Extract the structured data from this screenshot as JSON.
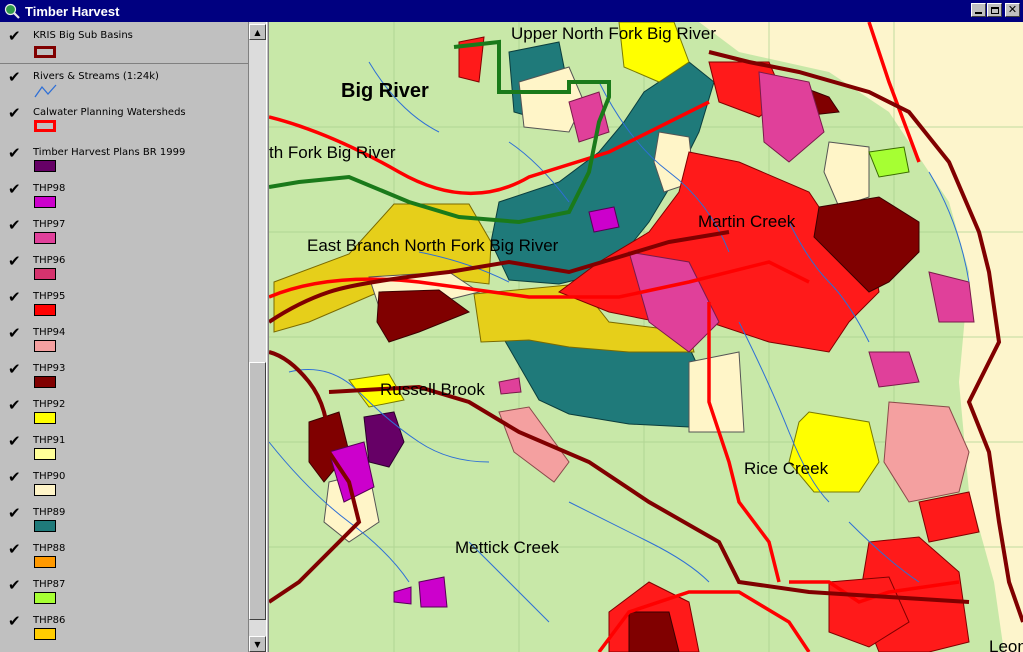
{
  "window": {
    "title": "Timber Harvest",
    "icon": "globe-search-icon",
    "buttons": [
      "minimize",
      "maximize",
      "close"
    ]
  },
  "legend": {
    "layers": [
      {
        "name": "KRIS Big Sub Basins",
        "checked": true,
        "symbol": "outline",
        "color": "#800000"
      },
      {
        "name": "Rivers & Streams (1:24k)",
        "checked": true,
        "symbol": "line",
        "color": "#2e6fd6"
      },
      {
        "name": "Calwater Planning Watersheds",
        "checked": true,
        "symbol": "outline",
        "color": "#ff0000"
      },
      {
        "name": "Timber Harvest Plans BR 1999",
        "checked": true,
        "symbol": "fill",
        "color": "#660066"
      },
      {
        "name": "THP98",
        "checked": true,
        "symbol": "fill",
        "color": "#cc00cc"
      },
      {
        "name": "THP97",
        "checked": true,
        "symbol": "fill",
        "color": "#e0409a"
      },
      {
        "name": "THP96",
        "checked": true,
        "symbol": "fill",
        "color": "#d6336e"
      },
      {
        "name": "THP95",
        "checked": true,
        "symbol": "fill",
        "color": "#ff0000"
      },
      {
        "name": "THP94",
        "checked": true,
        "symbol": "fill",
        "color": "#f4a0a0"
      },
      {
        "name": "THP93",
        "checked": true,
        "symbol": "fill",
        "color": "#800000"
      },
      {
        "name": "THP92",
        "checked": true,
        "symbol": "fill",
        "color": "#ffff00"
      },
      {
        "name": "THP91",
        "checked": true,
        "symbol": "fill",
        "color": "#ffff99"
      },
      {
        "name": "THP90",
        "checked": true,
        "symbol": "fill",
        "color": "#fff5c8"
      },
      {
        "name": "THP89",
        "checked": true,
        "symbol": "fill",
        "color": "#1f7a7a"
      },
      {
        "name": "THP88",
        "checked": true,
        "symbol": "fill",
        "color": "#ff9900"
      },
      {
        "name": "THP87",
        "checked": true,
        "symbol": "fill",
        "color": "#a6ff33"
      },
      {
        "name": "THP86",
        "checked": true,
        "symbol": "fill",
        "color": "#ffcc00"
      }
    ]
  },
  "map": {
    "labels": {
      "upper_north_fork": "Upper North Fork Big River",
      "big_river": "Big River",
      "north_fork": "th Fork Big River",
      "east_branch": "East Branch North Fork Big River",
      "martin_creek": "Martin Creek",
      "russell_brook": "Russell Brook",
      "rice_creek": "Rice Creek",
      "mettick_creek": "Mettick Creek",
      "leon": "Leon"
    },
    "colors": {
      "topo_base": "#c8e8a8",
      "outside": "#fdf5cc",
      "basin_outline": "#800000",
      "watershed_outline": "#ff0000",
      "forest_outline": "#1a7a1a",
      "streams": "#2e6fd6"
    }
  }
}
